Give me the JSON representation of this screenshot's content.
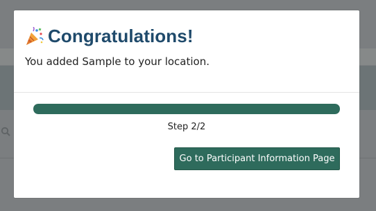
{
  "modal": {
    "title": "Congratulations!",
    "title_icon": "party-popper-icon",
    "message": "You added Sample to your location.",
    "progress": {
      "current_step": 2,
      "total_steps": 2,
      "fraction": 1.0,
      "label": "Step 2/2"
    },
    "primary_button_label": "Go to Participant Information Page"
  },
  "background": {
    "search_icon": "search-icon"
  },
  "colors": {
    "title": "#1f4a6b",
    "accent": "#2e6b5c",
    "overlay": "#7b7e80"
  }
}
